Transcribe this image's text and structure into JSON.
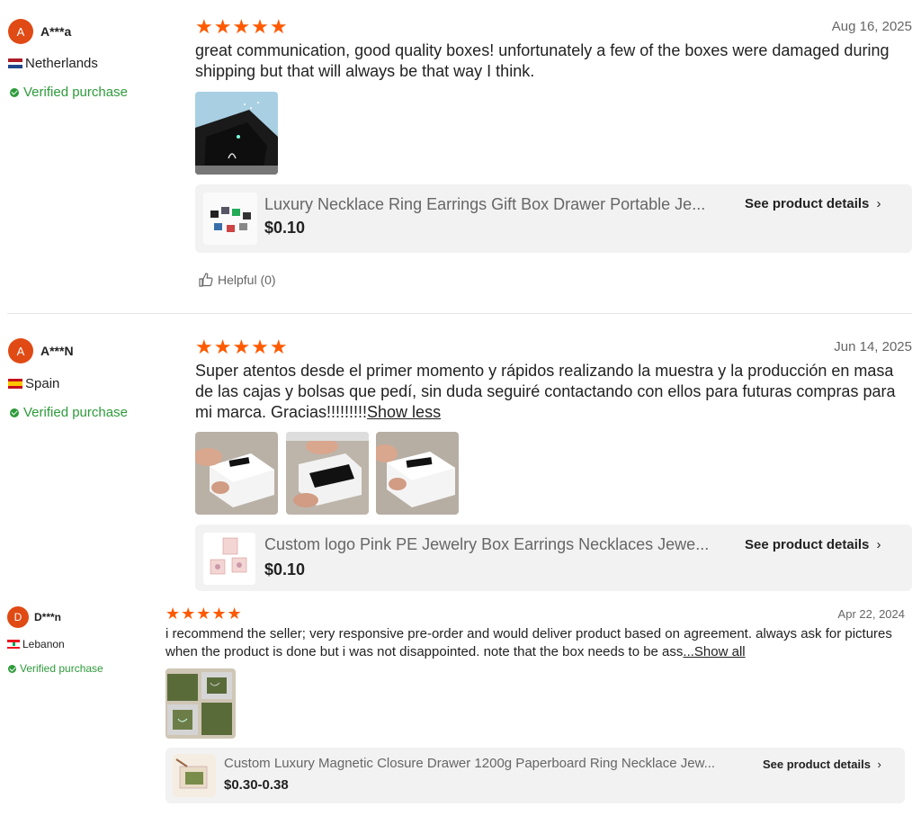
{
  "reviews": [
    {
      "avatar_letter": "A",
      "name": "A***a",
      "country": "Netherlands",
      "verified": "Verified purchase",
      "stars": "★★★★★",
      "date": "Aug 16, 2025",
      "text": "great communication, good quality boxes! unfortunately a few of the boxes were damaged during shipping but that will always be that way I think.",
      "product": {
        "title": "Luxury Necklace Ring Earrings Gift Box Drawer Portable Je...",
        "price": "$0.10",
        "details": "See product details"
      },
      "helpful": "Helpful (0)"
    },
    {
      "avatar_letter": "A",
      "name": "A***N",
      "country": "Spain",
      "verified": "Verified purchase",
      "stars": "★★★★★",
      "date": "Jun 14, 2025",
      "text": "Super atentos desde el primer momento y rápidos realizando la muestra y la producción en masa de las cajas y bolsas que pedí, sin duda seguiré contactando con ellos para futuras compras para mi marca. Gracias!!!!!!!!!",
      "toggle": "Show less",
      "product": {
        "title": "Custom logo Pink PE Jewelry Box Earrings Necklaces Jewe...",
        "price": "$0.10",
        "details": "See product details"
      }
    },
    {
      "avatar_letter": "D",
      "name": "D***n",
      "country": "Lebanon",
      "verified": "Verified purchase",
      "stars": "★★★★★",
      "date": "Apr 22, 2024",
      "text": "i recommend the seller; very responsive pre-order and would deliver product based on agreement. always ask for pictures when the product is done but i was not disappointed. note that the box needs to be ass",
      "toggle": "...Show all",
      "product": {
        "title": "Custom Luxury Magnetic Closure Drawer 1200g Paperboard Ring Necklace Jew...",
        "price": "$0.30-0.38",
        "details": "See product details"
      }
    }
  ]
}
